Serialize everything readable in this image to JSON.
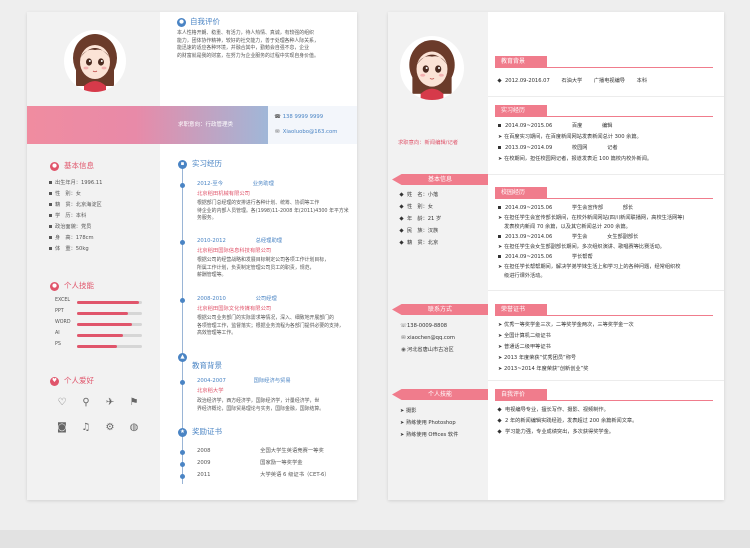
{
  "p1": {
    "self_eval": {
      "title": "自我评价",
      "lines": [
        "本人性格开朗、稳重、有活力，待人热情、真诚，有较强的组织",
        "能力，团体协作精神，较好的社交能力，善于处理各种人际关系，",
        "能迅速的适应各种环境，并融合其中，勤勉会自强不息，企业",
        "的财富就是我的财富，在努力为企业服务的过程中实现自身价值。"
      ]
    },
    "job_intent": "求职意向：行政管理类",
    "contact": {
      "phone": "138 9999 9999",
      "email": "Xiaoluobo@163.com"
    },
    "basic": {
      "title": "基本信息",
      "rows": [
        "出生年月：1996.11",
        "性　别：女",
        "籍　贯：北京海淀区",
        "学　历：本科",
        "政治面貌：党员",
        "身　高：178cm",
        "体　重：50kg"
      ]
    },
    "skills": {
      "title": "个人技能",
      "items": [
        {
          "name": "EXCEL",
          "level": 0.95
        },
        {
          "name": "PPT",
          "level": 0.78
        },
        {
          "name": "WORD",
          "level": 0.85
        },
        {
          "name": "AI",
          "level": 0.7
        },
        {
          "name": "PS",
          "level": 0.62
        }
      ]
    },
    "hobbies": {
      "title": "个人爱好",
      "icons": [
        "heart-icon",
        "bicycle-icon",
        "plane-icon",
        "run-icon",
        "camera-icon",
        "music-icon",
        "game-icon",
        "basketball-icon"
      ]
    },
    "experience": {
      "title": "实习经历",
      "items": [
        {
          "date": "2012-至今",
          "role": "业务助理",
          "company": "北京稻田机械有限公司",
          "desc": [
            "根据部门总经理的安排进行各种计划、统筹、协调等工作",
            "待企业的内部人员管理。各(1998)11-2008 年(2011)4300 年平方米",
            "务服务。"
          ]
        },
        {
          "date": "2010-2012",
          "role": "总经理助理",
          "company": "北京稻田国际信息科技有限公司",
          "desc": [
            "根据公司的经营战略和发展目标制定公司各项工作计划目标，",
            "所属工作计划，负责制定管理公司员工的职责，规范，",
            "薪酬管理等。"
          ]
        },
        {
          "date": "2008-2010",
          "role": "公司经理",
          "company": "北京稻田国际文化传媒有限公司",
          "desc": [
            "根据公司业务部门的实际需求等情况，深入、细致地开展部门的",
            "各项管理工作，监督落实；根据业务流程为各部门提供必要的支持，",
            "高效管理等工作。"
          ]
        }
      ]
    },
    "education": {
      "title": "教育背景",
      "date": "2004-2007",
      "major": "国际经济与贸易",
      "school": "北京稻大学",
      "desc": [
        "政治经济学，西方经济学，国际经济学，计量经济学，世",
        "界经济概论，国际贸易理论与实务，国际金融，国际结算。"
      ]
    },
    "awards": {
      "title": "奖励证书",
      "items": [
        {
          "year": "2008",
          "text": "全国大学生英语竞赛一等奖"
        },
        {
          "year": "2009",
          "text": "国家励一等奖学金"
        },
        {
          "year": "2011",
          "text": "大学英语 6 级证书（CET-6）"
        }
      ]
    }
  },
  "p2": {
    "job_intent": "求职意向：新闻编辑/记者",
    "basic": {
      "title": "基本信息",
      "rows": [
        "姓　名：小落",
        "性　别：女",
        "年　龄：21 岁",
        "民　族：汉族",
        "籍　贯：北京"
      ]
    },
    "contact": {
      "title": "联系方式",
      "phone": "138-0009-8808",
      "email": "xiaochen@qq.com",
      "address": "河北省唐山市古冶区"
    },
    "skills": {
      "title": "个人技能",
      "rows": [
        "摄影",
        "熟练使用 Photoshop",
        "熟练使用 Offices 软件"
      ]
    },
    "education": {
      "title": "教育背景",
      "date": "2012.09-2016.07",
      "school": "石油大学",
      "major": "广播电视编导",
      "degree": "本科"
    },
    "intern": {
      "title": "实习经历",
      "items": [
        {
          "date": "2014.09~2015.06",
          "org": "百度",
          "role": "编辑",
          "desc": "在百度实习期间，在百度新闻网站发表新闻总计 300 余篇。"
        },
        {
          "date": "2013.09~2014.09",
          "org": "校园网",
          "role": "记者",
          "desc": "在校期间，担任校园网记者，报道发表近 100 篇校内校外新闻。"
        }
      ]
    },
    "campus": {
      "title": "校园经历",
      "items": [
        {
          "date": "2014.09~2015.06",
          "org": "学生会宣传部",
          "role": "部长",
          "desc": [
            "在担任学生会宣传部长期间，在校外新闻网站(四川新闻联播网，高校生活网等)",
            "发表校内新闻 70 余篇，以及其它新闻总计 200 余篇。"
          ]
        },
        {
          "date": "2013.09~2014.06",
          "org": "学生会",
          "role": "女生部副部长",
          "desc": [
            "在担任学生会女生部副部长期间，多次组织演讲、歌唱赛等比赛活动。"
          ]
        },
        {
          "date": "2014.09~2015.06",
          "org": "学长帮帮",
          "role": "",
          "desc": [
            "在担任学长帮帮期间，解决学弟学妹生活上和学习上的各种问题，经常组织校",
            "级进行课外活动。"
          ]
        }
      ]
    },
    "certs": {
      "title": "荣誉证书",
      "rows": [
        "优秀一等奖学金三次，二等奖学金两次，三等奖学金一次",
        "全国计算机二级证书",
        "普通话二级甲等证书",
        "2013 年度荣获“优秀团员”称号",
        "2013~2014 年度荣获“创新创业”奖"
      ]
    },
    "self_eval": {
      "title": "自我评价",
      "rows": [
        "电视编导专业，擅长写作、摄影、视频制作。",
        "2 年的新闻编辑实践经验，发表超过 200 余篇新闻文章。",
        "学习能力强，专业成绩突出，多次获得奖学金。"
      ]
    }
  }
}
